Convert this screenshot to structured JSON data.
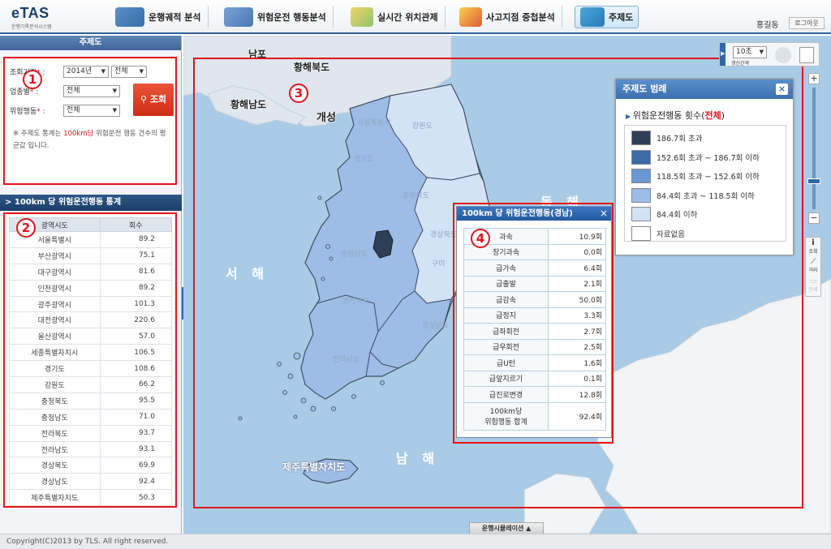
{
  "app": {
    "logo": "eTAS",
    "logo_sub": "운행기록분석시스템",
    "user": "홍길동",
    "logout": "로그아웃"
  },
  "nav": [
    {
      "label": "운행궤적 분석"
    },
    {
      "label": "위험운전 행동분석"
    },
    {
      "label": "실시간 위치관제"
    },
    {
      "label": "사고지점 중첩분석"
    },
    {
      "label": "주제도"
    }
  ],
  "left": {
    "title": "주제도",
    "filters": {
      "period_label": "조회기간",
      "period_year": "2014년",
      "period_month": "전체",
      "type_label": "업종별",
      "type_value": "전체",
      "risk_label": "위험행동",
      "risk_value": "전체",
      "required_mark": "*",
      "separator": ":",
      "search_label": "조회"
    },
    "note_pre": "※ 주제도 통계는 ",
    "note_hl": "100km당",
    "note_post": " 위험운전 행동 건수의 평균값 입니다.",
    "stat_title": "> 100km 당 위험운전행동 통계",
    "table_headers": [
      "광역시도",
      "회수"
    ],
    "rows": [
      [
        "서울특별시",
        "89.2"
      ],
      [
        "부산광역시",
        "75.1"
      ],
      [
        "대구광역시",
        "81.6"
      ],
      [
        "인천광역시",
        "89.2"
      ],
      [
        "광주광역시",
        "101.3"
      ],
      [
        "대전광역시",
        "220.6"
      ],
      [
        "울산광역시",
        "57.0"
      ],
      [
        "세종특별자치시",
        "106.5"
      ],
      [
        "경기도",
        "108.6"
      ],
      [
        "강원도",
        "66.2"
      ],
      [
        "충청북도",
        "95.5"
      ],
      [
        "충청남도",
        "71.0"
      ],
      [
        "전라북도",
        "93.7"
      ],
      [
        "전라남도",
        "93.1"
      ],
      [
        "경상북도",
        "69.9"
      ],
      [
        "경상남도",
        "92.4"
      ],
      [
        "제주특별자치도",
        "50.3"
      ]
    ]
  },
  "annotations": {
    "n1": "1",
    "n2": "2",
    "n3": "3",
    "n4": "4"
  },
  "map": {
    "labels": {
      "nampo": "남포",
      "hwanghae_n": "황해북도",
      "hwanghae_s": "황해남도",
      "kaesong": "개성",
      "west_sea": "서 해",
      "east_sea": "동 해",
      "south_sea": "남 해",
      "jeju": "제주특별자치도",
      "gangwon": "강원도",
      "gyeonggi": "경기도",
      "chungbuk": "충청북도",
      "chungnam": "충청남도",
      "gyeongbuk": "경상북도",
      "gyeongnam": "경상남도",
      "jeonbuk": "전라북도",
      "jeonnam": "전라남도",
      "seoul": "서울특별시",
      "gumi": "구미"
    },
    "time_value": "10초",
    "time_label": "갱신간격",
    "zoom_plus": "+",
    "zoom_minus": "−",
    "tools": {
      "inquiry": "조회",
      "distance": "거리",
      "print": "인쇄"
    },
    "sim_button": "운행시뮬레이션 ▲"
  },
  "legend": {
    "title": "주제도 범례",
    "close": "×",
    "sub_pre": "위험운전행동 횟수(",
    "sub_red": "전체",
    "sub_post": ")",
    "items": [
      {
        "color": "#2e3e55",
        "label": "186.7회 초과"
      },
      {
        "color": "#3d6aa6",
        "label": "152.6회 초과 ~ 186.7회 이하"
      },
      {
        "color": "#6b97d3",
        "label": "118.5회 초과 ~ 152.6회 이하"
      },
      {
        "color": "#9dbce6",
        "label": "84.4회 초과 ~ 118.5회 이하"
      },
      {
        "color": "#d3e2f5",
        "label": "84.4회 이하"
      },
      {
        "color": "#ffffff",
        "label": "자료없음"
      }
    ]
  },
  "popup": {
    "title": "100km 당 위험운전행동(경남)",
    "close": "×",
    "rows": [
      [
        "과속",
        "10.9회"
      ],
      [
        "장기과속",
        "0.0회"
      ],
      [
        "급가속",
        "6.4회"
      ],
      [
        "급출발",
        "2.1회"
      ],
      [
        "급감속",
        "50.0회"
      ],
      [
        "급정지",
        "3.3회"
      ],
      [
        "급좌회전",
        "2.7회"
      ],
      [
        "급우회전",
        "2.5회"
      ],
      [
        "급U턴",
        "1.6회"
      ],
      [
        "급앞지르기",
        "0.1회"
      ],
      [
        "급진로변경",
        "12.8회"
      ],
      [
        "100km당\n위험행동 합계",
        "92.4회"
      ]
    ]
  },
  "footer": "Copyright(C)2013 by TLS. All right reserved."
}
